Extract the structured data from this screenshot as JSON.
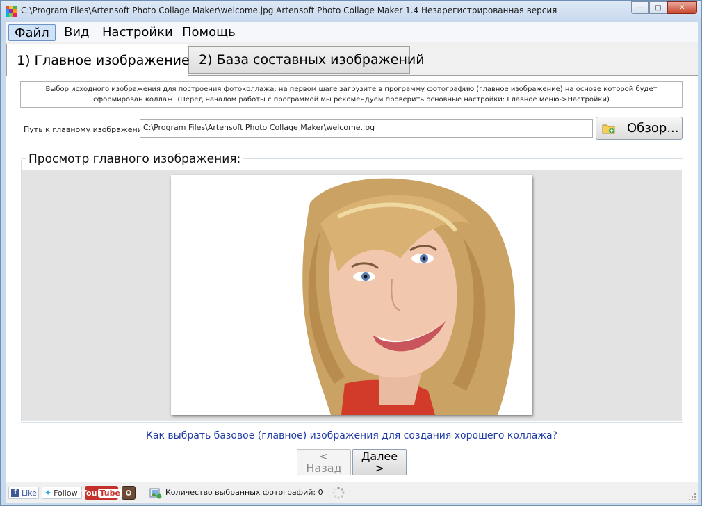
{
  "window": {
    "title": "C:\\Program Files\\Artensoft Photo Collage Maker\\welcome.jpg Artensoft Photo Collage Maker 1.4  Незарегистрированная версия"
  },
  "menu": {
    "file": "Файл",
    "view": "Вид",
    "settings": "Настройки",
    "help": "Помощь"
  },
  "tabs": {
    "main_image": "1) Главное изображение",
    "database": "2) База составных изображений"
  },
  "instructions": "Выбор исходного изображения для построения фотоколлажа: на первом шаге загрузите в программу фотографию (главное изображение) на основе которой будет сформирован коллаж. (Перед началом работы с программой мы рекомендуем проверить основные настройки: Главное меню->Настройки)",
  "path": {
    "label": "Путь к главному изображению:",
    "value": "C:\\Program Files\\Artensoft Photo Collage Maker\\welcome.jpg",
    "browse_label": "Обзор..."
  },
  "preview": {
    "title": "Просмотр главного изображения:"
  },
  "help_link": "Как выбрать базовое (главное) изображения для создания хорошего коллажа?",
  "nav": {
    "back_arrow": "<",
    "back_label": "Назад",
    "next_label": "Далее",
    "next_arrow": ">"
  },
  "statusbar": {
    "fb_label": "Like",
    "tw_label": "Follow",
    "yt_you": "You",
    "yt_tube": "Tube",
    "count_text": "Количество выбранных фотографий: 0"
  },
  "colors": {
    "link": "#1e3aa6",
    "menu_highlight": "#cfe2f8",
    "preview_bg": "#e3e3e3"
  }
}
